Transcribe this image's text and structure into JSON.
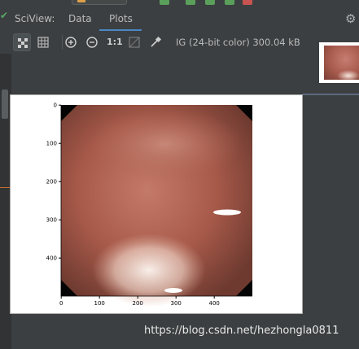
{
  "sciview": {
    "label": "SciView:",
    "tabs": [
      {
        "label": "Data",
        "active": false
      },
      {
        "label": "Plots",
        "active": true
      }
    ]
  },
  "toolbar": {
    "zoom_actual_label": "1:1",
    "image_info": "IG (24-bit color) 300.04 kB"
  },
  "plot": {
    "x_ticks": [
      "0",
      "100",
      "200",
      "300",
      "400"
    ],
    "y_ticks": [
      "0",
      "100",
      "200",
      "300",
      "400"
    ],
    "x_range": [
      0,
      500
    ],
    "y_range": [
      0,
      500
    ]
  },
  "watermark": "https://blog.csdn.net/hezhongla0811",
  "colors": {
    "ide_background": "#3c3f41",
    "active_tab_underline": "#4a88c7",
    "tissue": "#a85a4a",
    "highlight": "#f6e9e2"
  }
}
